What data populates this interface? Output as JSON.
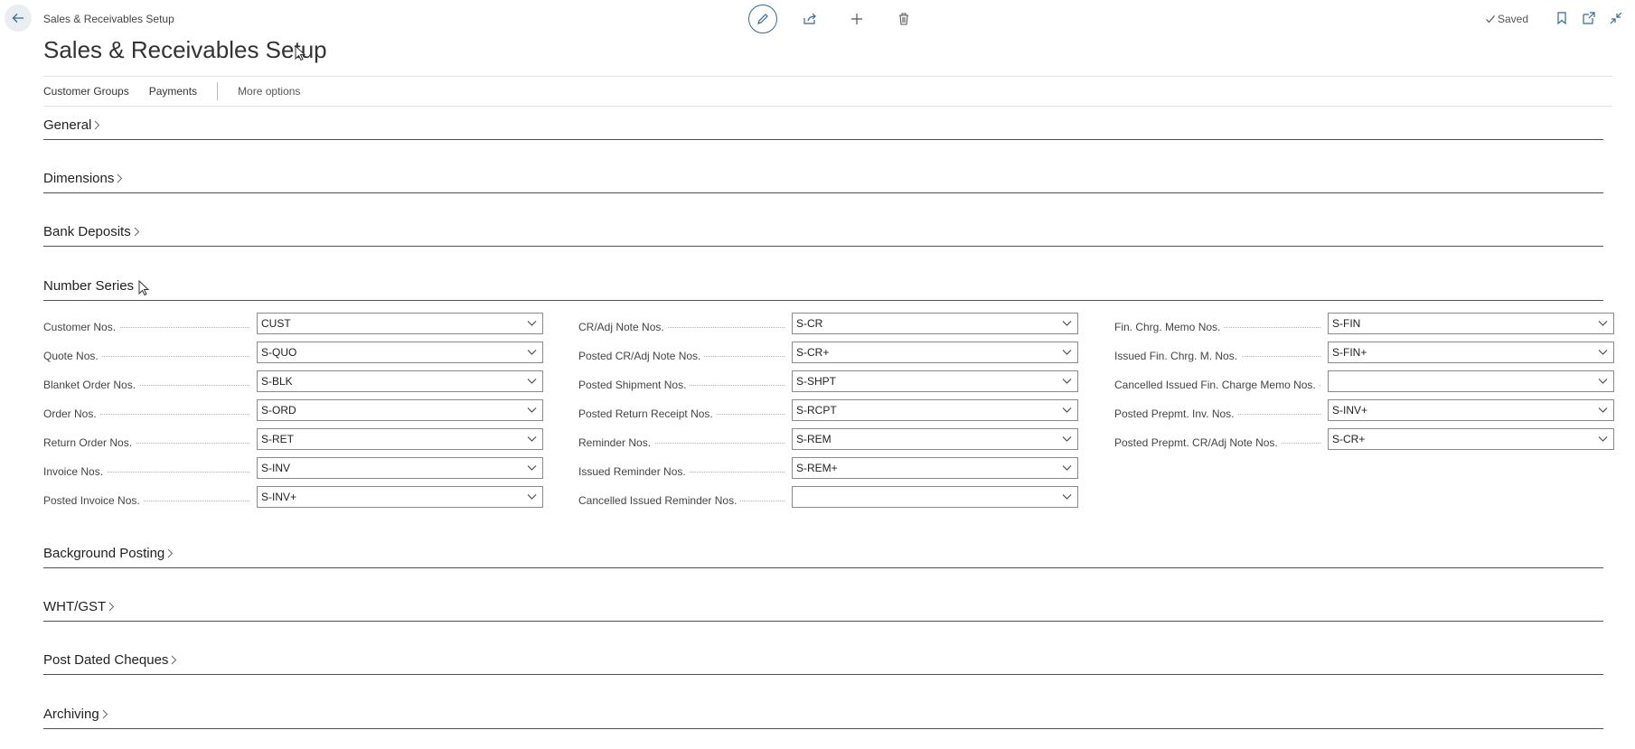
{
  "header": {
    "breadcrumb": "Sales & Receivables Setup",
    "title": "Sales & Receivables Setup",
    "saved_label": "Saved",
    "accent": "#2f6b96"
  },
  "actions": {
    "customer_groups": "Customer Groups",
    "payments": "Payments",
    "more_options": "More options"
  },
  "sections": {
    "general": "General",
    "dimensions": "Dimensions",
    "bank_deposits": "Bank Deposits",
    "number_series": "Number Series",
    "background_posting": "Background Posting",
    "wht_gst": "WHT/GST",
    "post_dated_cheques": "Post Dated Cheques",
    "archiving": "Archiving"
  },
  "number_series": {
    "col1": [
      {
        "label": "Customer Nos.",
        "value": "CUST"
      },
      {
        "label": "Quote Nos.",
        "value": "S-QUO"
      },
      {
        "label": "Blanket Order Nos.",
        "value": "S-BLK"
      },
      {
        "label": "Order Nos.",
        "value": "S-ORD"
      },
      {
        "label": "Return Order Nos.",
        "value": "S-RET"
      },
      {
        "label": "Invoice Nos.",
        "value": "S-INV"
      },
      {
        "label": "Posted Invoice Nos.",
        "value": "S-INV+"
      }
    ],
    "col2": [
      {
        "label": "CR/Adj Note Nos.",
        "value": "S-CR"
      },
      {
        "label": "Posted CR/Adj Note Nos.",
        "value": "S-CR+"
      },
      {
        "label": "Posted Shipment Nos.",
        "value": "S-SHPT"
      },
      {
        "label": "Posted Return Receipt Nos.",
        "value": "S-RCPT"
      },
      {
        "label": "Reminder Nos.",
        "value": "S-REM"
      },
      {
        "label": "Issued Reminder Nos.",
        "value": "S-REM+"
      },
      {
        "label": "Cancelled Issued Reminder Nos.",
        "value": ""
      }
    ],
    "col3": [
      {
        "label": "Fin. Chrg. Memo Nos.",
        "value": "S-FIN"
      },
      {
        "label": "Issued Fin. Chrg. M. Nos.",
        "value": "S-FIN+"
      },
      {
        "label": "Cancelled Issued Fin. Charge Memo Nos.",
        "value": ""
      },
      {
        "label": "Posted Prepmt. Inv. Nos.",
        "value": "S-INV+"
      },
      {
        "label": "Posted Prepmt. CR/Adj Note Nos.",
        "value": "S-CR+"
      }
    ]
  }
}
